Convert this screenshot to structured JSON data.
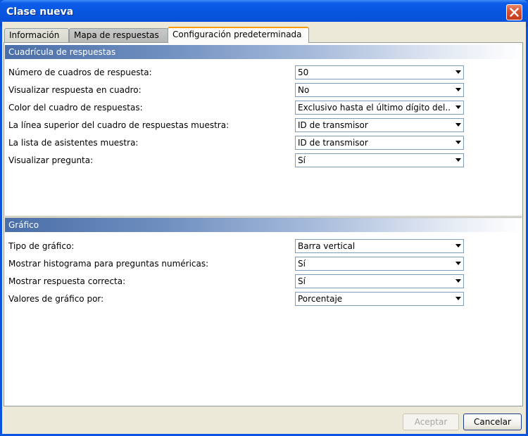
{
  "window": {
    "title": "Clase nueva",
    "close_icon": "close-icon"
  },
  "tabs": [
    {
      "label": "Información",
      "active": false
    },
    {
      "label": "Mapa de respuestas",
      "active": false
    },
    {
      "label": "Configuración predeterminada",
      "active": true
    }
  ],
  "grid_section": {
    "header": "Cuadrícula de respuestas",
    "rows": [
      {
        "label": "Número de cuadros de respuesta:",
        "value": "50"
      },
      {
        "label": "Visualizar respuesta en cuadro:",
        "value": "No"
      },
      {
        "label": "Color del cuadro de respuestas:",
        "value": "Exclusivo hasta el último dígito del..."
      },
      {
        "label": "La línea superior del cuadro de respuestas muestra:",
        "value": "ID de transmisor"
      },
      {
        "label": "La lista de asistentes muestra:",
        "value": "ID de transmisor"
      },
      {
        "label": "Visualizar pregunta:",
        "value": "Sí"
      }
    ]
  },
  "chart_section": {
    "header": "Gráfico",
    "rows": [
      {
        "label": "Tipo de gráfico:",
        "value": "Barra vertical"
      },
      {
        "label": "Mostrar histograma para preguntas numéricas:",
        "value": "Sí"
      },
      {
        "label": "Mostrar respuesta correcta:",
        "value": "Sí"
      },
      {
        "label": "Valores de gráfico por:",
        "value": "Porcentaje"
      }
    ]
  },
  "buttons": {
    "accept": "Aceptar",
    "cancel": "Cancelar"
  },
  "colors": {
    "titlebar": "#0856e0",
    "section_header": "#4a6ea8",
    "active_tab_accent": "#ff9c00",
    "close_button": "#d4502e"
  }
}
